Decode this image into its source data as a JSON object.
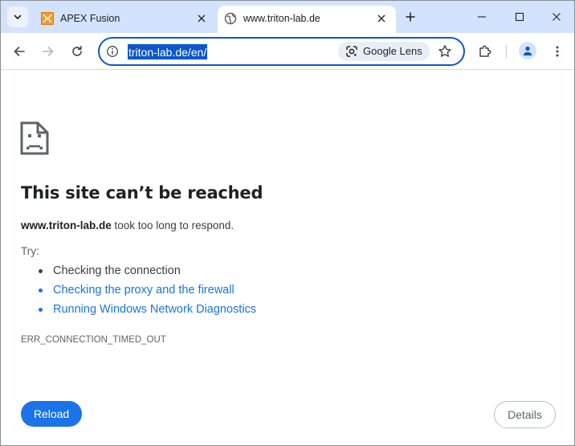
{
  "tabs": [
    {
      "title": "APEX Fusion",
      "favicon": "apex-fusion-favicon",
      "active": false
    },
    {
      "title": "www.triton-lab.de",
      "favicon": "globe-icon",
      "active": true
    }
  ],
  "omnibox": {
    "url": "triton-lab.de/en/",
    "lens_label": "Google Lens"
  },
  "error_page": {
    "headline": "This site can’t be reached",
    "host": "www.triton-lab.de",
    "description_suffix": " took too long to respond.",
    "try_label": "Try:",
    "suggestions": [
      {
        "text": "Checking the connection",
        "link": false
      },
      {
        "text": "Checking the proxy and the firewall",
        "link": true
      },
      {
        "text": "Running Windows Network Diagnostics",
        "link": true
      }
    ],
    "error_code": "ERR_CONNECTION_TIMED_OUT",
    "reload_label": "Reload",
    "details_label": "Details"
  },
  "colors": {
    "accent": "#1a73e8",
    "tabstrip": "#d3e3fd",
    "omnibox_focus": "#0b57d0"
  }
}
